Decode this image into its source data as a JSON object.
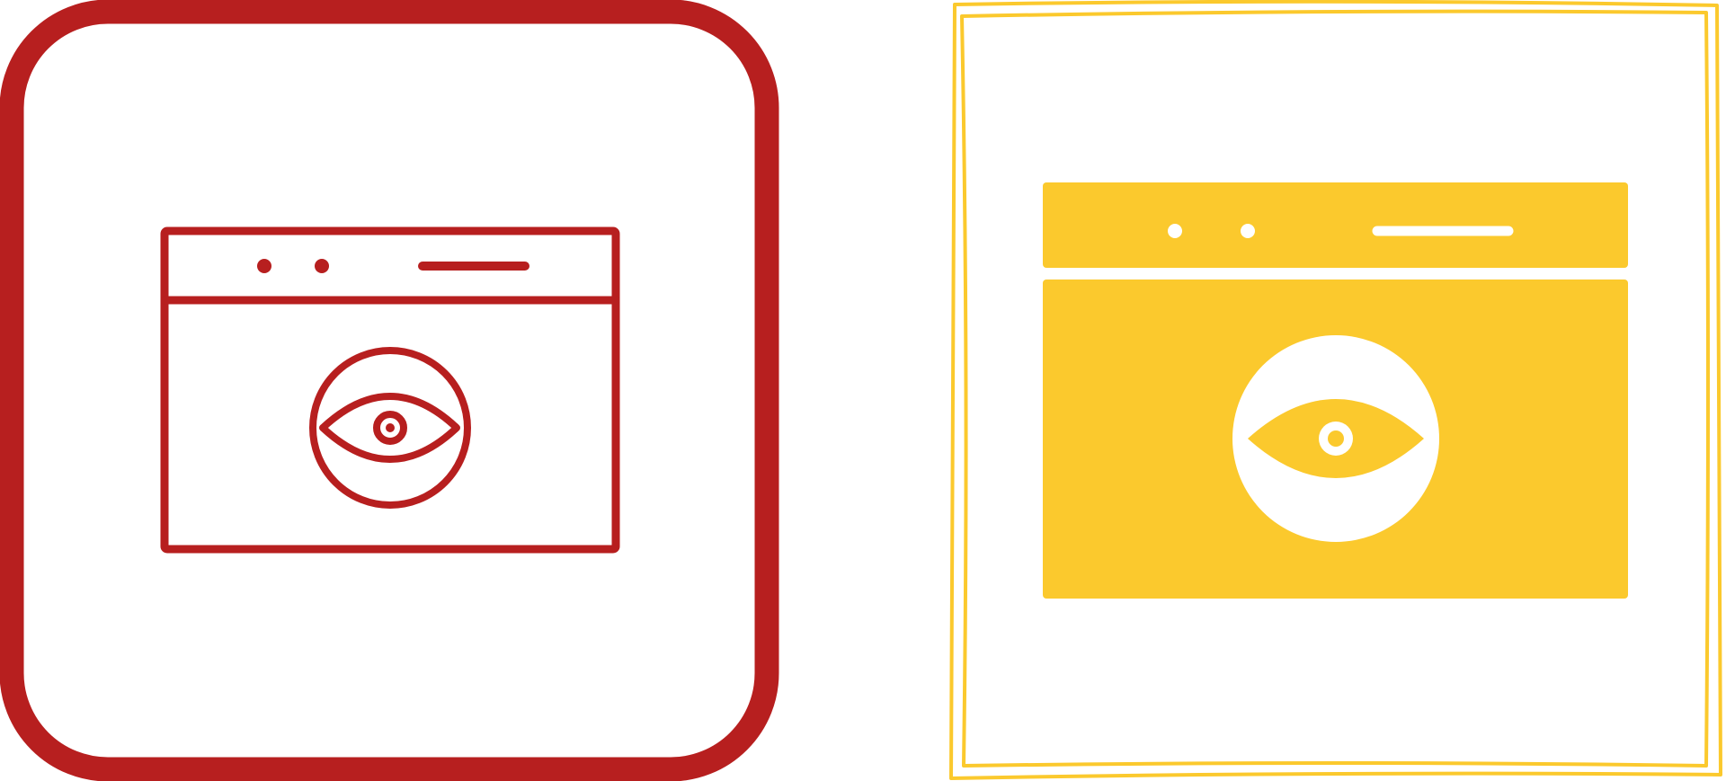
{
  "icons": [
    {
      "name": "browser-eye-outline-icon",
      "style": "outline",
      "frame": "rounded-square",
      "color": "#b71f1f"
    },
    {
      "name": "browser-eye-filled-icon",
      "style": "filled",
      "frame": "hand-drawn-square",
      "color": "#fbc92d"
    }
  ],
  "colors": {
    "background": "#ffffff",
    "red": "#b71f1f",
    "yellow": "#fbc92d"
  }
}
